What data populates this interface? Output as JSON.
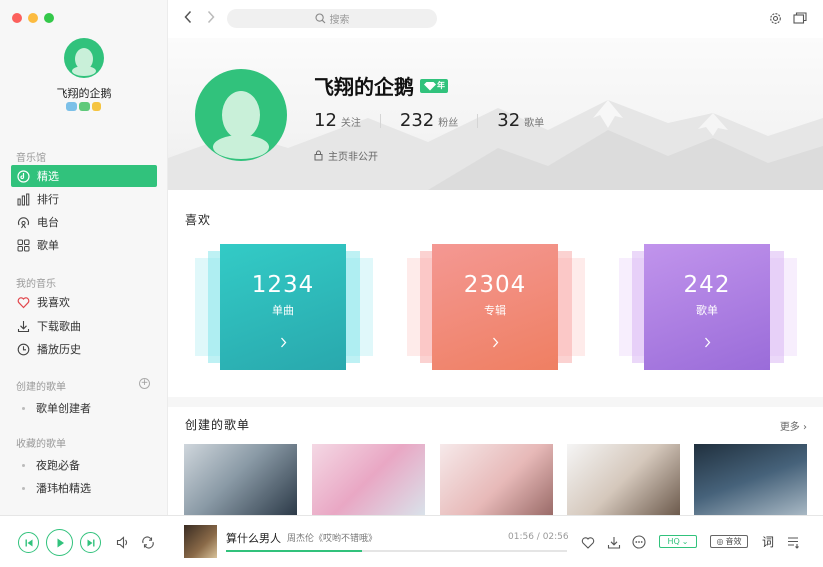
{
  "sidebar": {
    "user_name": "飞翔的企鹅",
    "sections": {
      "music_hall": "音乐馆",
      "my_music": "我的音乐",
      "created_playlists": "创建的歌单",
      "collected_playlists": "收藏的歌单"
    },
    "music_hall_items": [
      {
        "label": "精选",
        "icon": "disc-icon",
        "active": true
      },
      {
        "label": "排行",
        "icon": "chart-icon",
        "active": false
      },
      {
        "label": "电台",
        "icon": "radio-icon",
        "active": false
      },
      {
        "label": "歌单",
        "icon": "grid-icon",
        "active": false
      }
    ],
    "my_music_items": [
      {
        "label": "我喜欢",
        "icon": "heart-icon"
      },
      {
        "label": "下载歌曲",
        "icon": "download-icon"
      },
      {
        "label": "播放历史",
        "icon": "clock-icon"
      }
    ],
    "created_items": [
      "歌单创建者"
    ],
    "collected_items": [
      "夜跑必备",
      "潘玮柏精选"
    ]
  },
  "topbar": {
    "search_placeholder": "搜索"
  },
  "profile": {
    "name": "飞翔的企鹅",
    "vip_badge": "年",
    "stats": [
      {
        "num": "12",
        "label": "关注"
      },
      {
        "num": "232",
        "label": "粉丝"
      },
      {
        "num": "32",
        "label": "歌单"
      }
    ],
    "privacy": "主页非公开"
  },
  "likes": {
    "title": "喜欢",
    "cards": [
      {
        "num": "1234",
        "label": "单曲",
        "color_from": "#31c7c2",
        "color_to": "#3aa7a3",
        "layer": "#7ee3e9"
      },
      {
        "num": "2304",
        "label": "专辑",
        "color_from": "#f58a84",
        "color_to": "#f07e6a",
        "layer": "#f8a6a4"
      },
      {
        "num": "242",
        "label": "歌单",
        "color_from": "#b98ae6",
        "color_to": "#9b6fdb",
        "layer": "#d7b2f3"
      }
    ]
  },
  "created": {
    "title": "创建的歌单",
    "more": "更多"
  },
  "player": {
    "song": "算什么男人",
    "artist": "周杰伦《哎哟不错哦》",
    "time": "01:56 / 02:56",
    "progress": 0.4,
    "hq": "HQ",
    "effect": "音效",
    "lyric": "词"
  },
  "colors": {
    "accent": "#31c27c"
  }
}
